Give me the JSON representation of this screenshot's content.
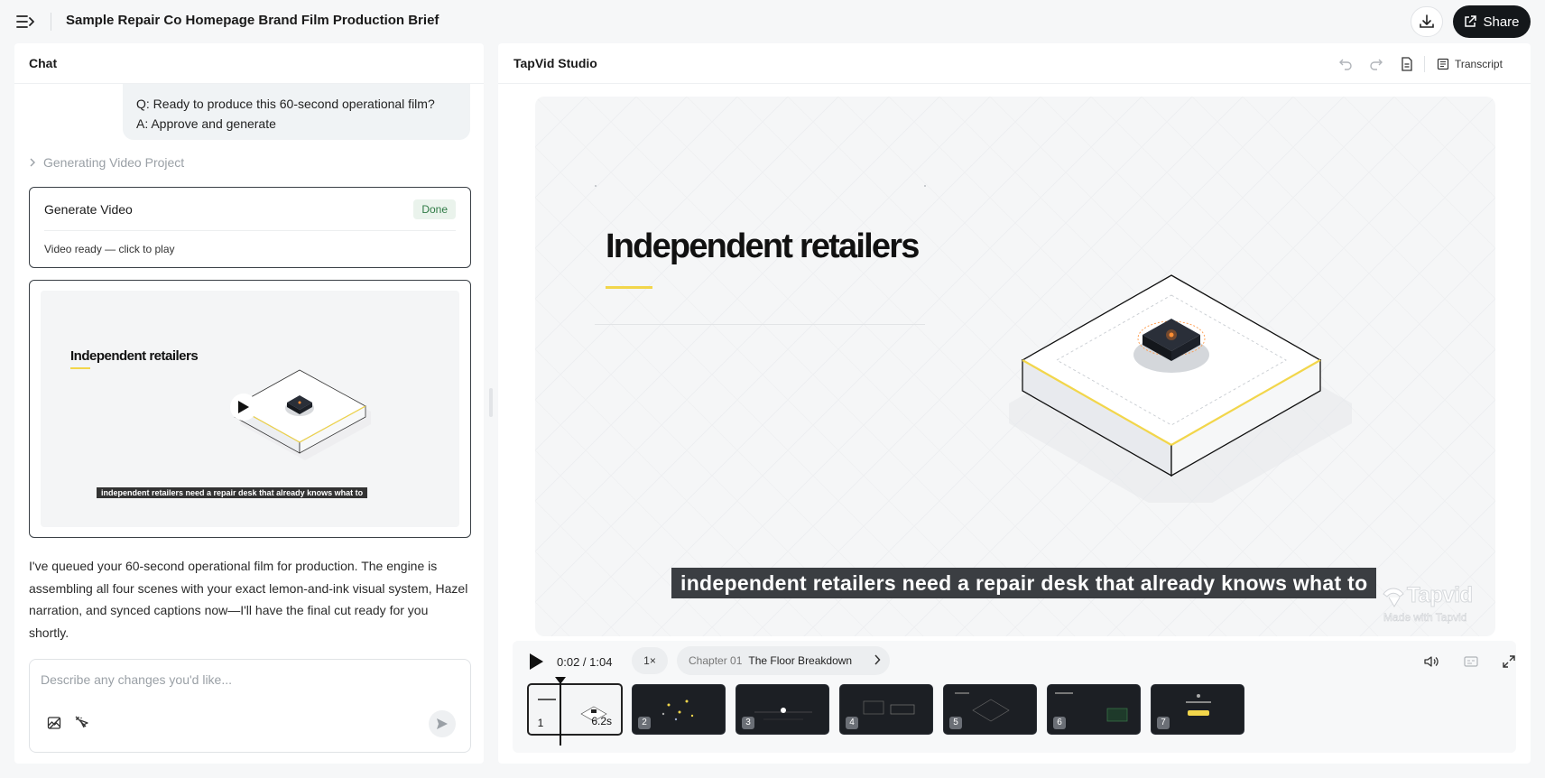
{
  "header": {
    "title": "Sample Repair Co Homepage Brand Film Production Brief",
    "share_label": "Share"
  },
  "chat": {
    "title": "Chat",
    "user_message": {
      "question": "Q: Ready to produce this 60-second operational film?",
      "answer": "A: Approve and generate"
    },
    "generating_label": "Generating Video Project",
    "generate_card": {
      "title": "Generate Video",
      "status_badge": "Done",
      "status_text": "Video ready — click to play"
    },
    "preview": {
      "title": "Independent retailers",
      "caption": "independent retailers need a repair desk that already knows what to"
    },
    "assistant_message": "I've queued your 60-second operational film for production. The engine is assembling all four scenes with your exact lemon-and-ink visual system, Hazel narration, and synced captions now—I'll have the final cut ready for you shortly.",
    "composer_placeholder": "Describe any changes you'd like..."
  },
  "studio": {
    "title": "TapVid Studio",
    "transcript_label": "Transcript",
    "scene": {
      "title": "Independent retailers",
      "caption": "independent retailers need a repair desk that already knows what to",
      "watermark": "Tapvid",
      "watermark_sub": "Made with Tapvid"
    },
    "player": {
      "time": "0:02 / 1:04",
      "speed": "1×",
      "chapter_number": "Chapter 01",
      "chapter_name": "The Floor Breakdown"
    },
    "thumbnails": [
      {
        "num": "1",
        "duration": "6.2s",
        "active": true
      },
      {
        "num": "2"
      },
      {
        "num": "3"
      },
      {
        "num": "4"
      },
      {
        "num": "5"
      },
      {
        "num": "6"
      },
      {
        "num": "7"
      }
    ]
  },
  "colors": {
    "accent_yellow": "#f2d64b",
    "ink": "#14171a",
    "done_green": "#2f7a45"
  }
}
